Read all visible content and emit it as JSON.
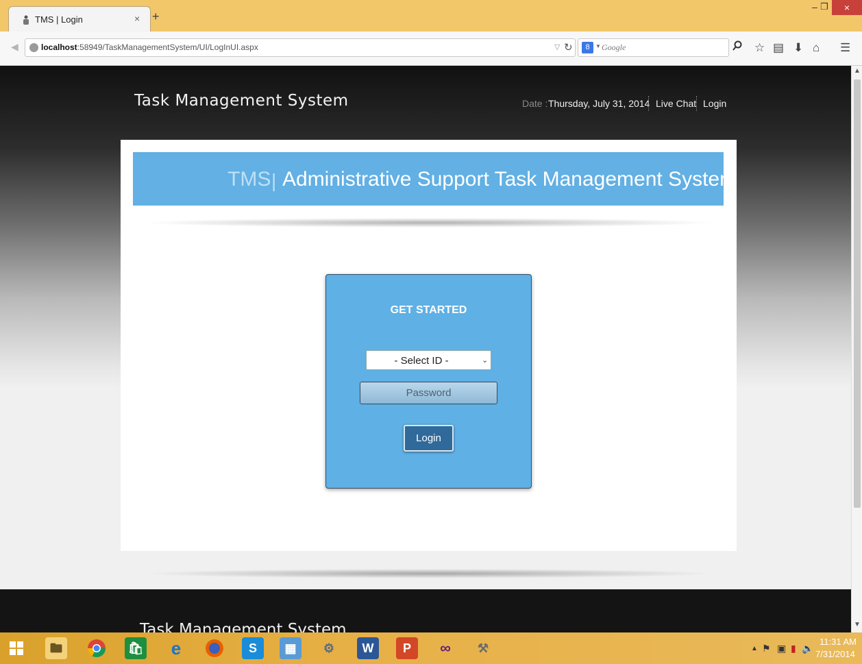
{
  "browser": {
    "tab_title": "TMS | Login",
    "tab_close": "×",
    "new_tab": "+",
    "url_host": "localhost",
    "url_rest": ":58949/TaskManagementSystem/UI/LogInUI.aspx",
    "search_placeholder": "Google",
    "search_engine_badge": "8",
    "window_controls": {
      "minimize": "–",
      "maximize": "❐",
      "close": "×"
    }
  },
  "header": {
    "site_title": "Task Management System",
    "date_label": "Date :",
    "date_value": "Thursday, July 31, 2014",
    "links": [
      "Live Chat",
      "Login"
    ]
  },
  "banner": {
    "abbr": "TMS",
    "separator": "|",
    "title": "Administrative Support Task Management System"
  },
  "login_form": {
    "heading": "GET STARTED",
    "select_id_value": "- Select ID -",
    "password_placeholder": "Password",
    "login_button": "Login"
  },
  "footer": {
    "title": "Task Management System"
  },
  "taskbar": {
    "clock_time": "11:31 AM",
    "clock_date": "7/31/2014",
    "apps": [
      "start-icon",
      "file-explorer-icon",
      "chrome-icon",
      "store-icon",
      "internet-explorer-icon",
      "firefox-icon",
      "skype-icon",
      "control-panel-icon",
      "settings-icon",
      "word-icon",
      "powerpoint-icon",
      "visual-studio-icon",
      "tools-icon"
    ]
  },
  "colors": {
    "banner_blue": "#62b0e4",
    "login_box_blue": "#5eb0e5",
    "login_button": "#2f6a9a",
    "taskbar": "#e7b046"
  }
}
